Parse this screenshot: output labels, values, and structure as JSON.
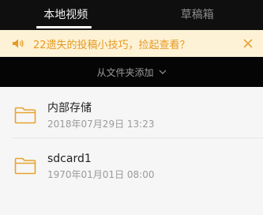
{
  "tabs": [
    {
      "label": "本地视频",
      "active": true
    },
    {
      "label": "草稿箱",
      "active": false
    }
  ],
  "tip": {
    "icon": "speaker-icon",
    "text": "22遗失的投稿小技巧，捡起查看？",
    "close_icon": "close-icon",
    "accent_color": "#e59b25"
  },
  "addbar": {
    "label": "从文件夹添加",
    "icon": "chevron-down-icon"
  },
  "folders": [
    {
      "name": "内部存储",
      "date": "2018年07月29日 13:23",
      "icon": "folder-icon"
    },
    {
      "name": "sdcard1",
      "date": "1970年01月01日 08:00",
      "icon": "folder-icon"
    }
  ]
}
